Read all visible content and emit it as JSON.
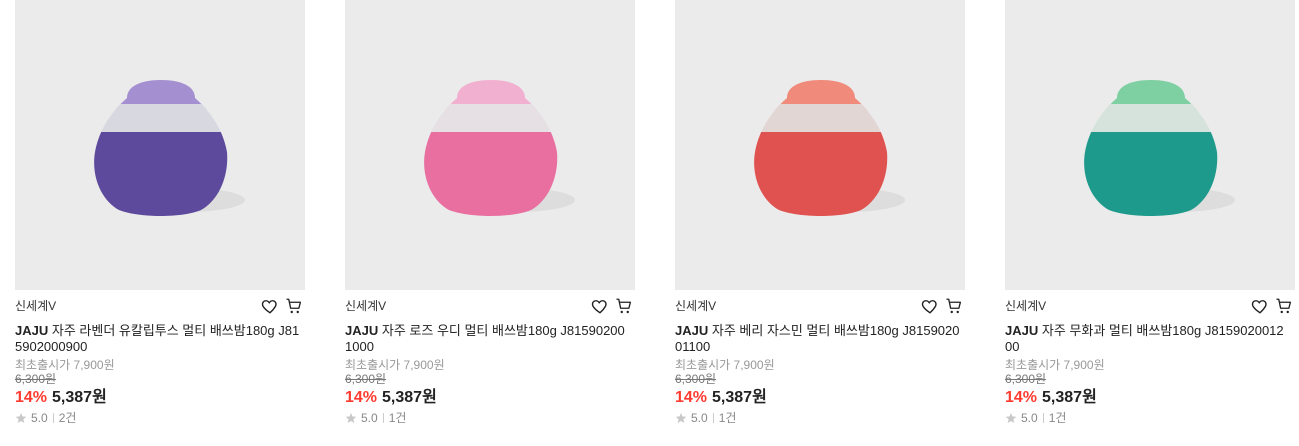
{
  "products": [
    {
      "store": "신세계V",
      "brand": "JAJU",
      "name": "자주 라벤더 유칼립투스 멀티 배쓰밤180g J815902000900",
      "origin_label": "최초출시가 7,900원",
      "original_price": "6,300원",
      "discount": "14%",
      "price": "5,387원",
      "rating": "5.0",
      "review_count": "2건",
      "colors": {
        "top": "#a48fd0",
        "band": "#d8d8e0",
        "bottom": "#5e4a9c"
      }
    },
    {
      "store": "신세계V",
      "brand": "JAJU",
      "name": "자주 로즈 우디 멀티 배쓰밤180g J815902001000",
      "origin_label": "최초출시가 7,900원",
      "original_price": "6,300원",
      "discount": "14%",
      "price": "5,387원",
      "rating": "5.0",
      "review_count": "1건",
      "colors": {
        "top": "#f2b0d0",
        "band": "#e6e0e4",
        "bottom": "#e86fa0"
      }
    },
    {
      "store": "신세계V",
      "brand": "JAJU",
      "name": "자주 베리 자스민 멀티 배쓰밤180g J815902001100",
      "origin_label": "최초출시가 7,900원",
      "original_price": "6,300원",
      "discount": "14%",
      "price": "5,387원",
      "rating": "5.0",
      "review_count": "1건",
      "colors": {
        "top": "#f08a7a",
        "band": "#e2d6d4",
        "bottom": "#e0524f"
      }
    },
    {
      "store": "신세계V",
      "brand": "JAJU",
      "name": "자주 무화과 멀티 배쓰밤180g J815902001200",
      "origin_label": "최초출시가 7,900원",
      "original_price": "6,300원",
      "discount": "14%",
      "price": "5,387원",
      "rating": "5.0",
      "review_count": "1건",
      "colors": {
        "top": "#7ecfa2",
        "band": "#d6e2dc",
        "bottom": "#1e9a8c"
      }
    }
  ],
  "icons": {
    "wishlist": "heart-icon",
    "cart": "cart-icon",
    "rating": "star-icon"
  },
  "accent": {
    "discount": "#ff3b30"
  }
}
